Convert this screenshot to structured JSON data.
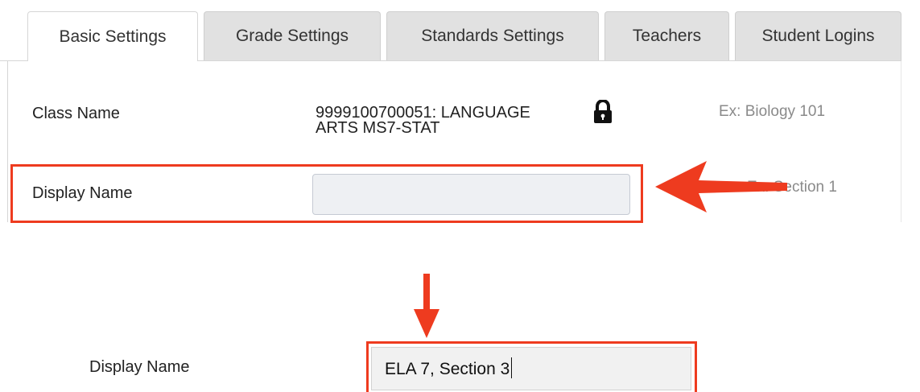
{
  "tabs": [
    {
      "label": "Basic Settings",
      "active": true
    },
    {
      "label": "Grade Settings",
      "active": false
    },
    {
      "label": "Standards Settings",
      "active": false
    },
    {
      "label": "Teachers",
      "active": false
    },
    {
      "label": "Student Logins",
      "active": false
    }
  ],
  "form": {
    "class_name_label": "Class Name",
    "class_name_value_line1": "9999100700051: LANGUAGE",
    "class_name_value_line2": "ARTS MS7-STAT",
    "class_name_hint": "Ex: Biology 101",
    "display_name_label": "Display Name",
    "display_name_value": "",
    "display_name_hint": "Ex: Section 1"
  },
  "example": {
    "display_name_label": "Display Name",
    "display_name_value": "ELA 7, Section 3"
  },
  "icons": {
    "lock": "lock-icon",
    "arrow_left": "arrow-left-icon",
    "arrow_down": "arrow-down-icon"
  },
  "colors": {
    "highlight": "#ee3b1f",
    "tab_inactive": "#e1e1e1",
    "hint_text": "#8a8a8a"
  }
}
